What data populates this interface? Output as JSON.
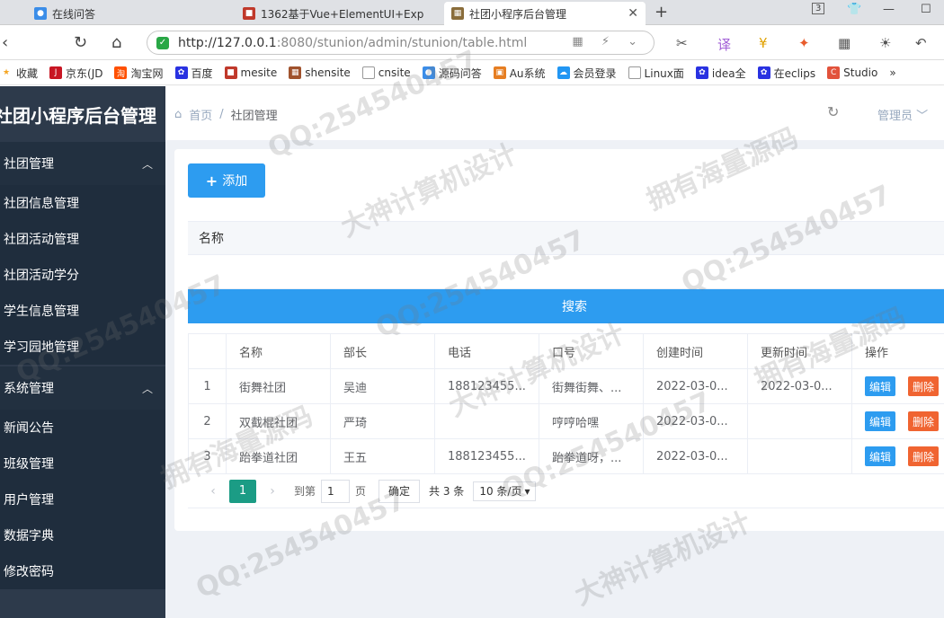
{
  "browser": {
    "tabs": [
      {
        "title": "在线问答",
        "active": false
      },
      {
        "title": "1362基于Vue+ElementUI+Exp",
        "active": false
      },
      {
        "title": "社团小程序后台管理",
        "active": true
      }
    ],
    "url_prefix": "http://127.0.0.1",
    "url_rest": ":8080/stunion/admin/stunion/table.html",
    "tab_badge": "3",
    "bookmarks": [
      "收藏",
      "京东(JD",
      "淘宝网",
      "百度",
      "mesite",
      "shensite",
      "cnsite",
      "源码问答",
      "Au系统",
      "会员登录",
      "Linux面",
      "idea全",
      "在eclips",
      "Studio",
      "»"
    ]
  },
  "sidebar": {
    "title": "社团小程序后台管理",
    "groups": [
      {
        "label": "社团管理",
        "items": [
          "社团信息管理",
          "社团活动管理",
          "社团活动学分",
          "学生信息管理",
          "学习园地管理"
        ]
      },
      {
        "label": "系统管理",
        "items": [
          "新闻公告",
          "班级管理",
          "用户管理",
          "数据字典",
          "修改密码"
        ]
      }
    ]
  },
  "header": {
    "breadcrumb_home": "首页",
    "breadcrumb_sep": "/",
    "breadcrumb_current": "社团管理",
    "user_label": "管理员"
  },
  "toolbar": {
    "add_label": "添加",
    "filter_label": "名称",
    "search_label": "搜索"
  },
  "table": {
    "columns": [
      "",
      "名称",
      "部长",
      "电话",
      "口号",
      "创建时间",
      "更新时间",
      "操作"
    ],
    "edit_label": "编辑",
    "delete_label": "删除",
    "rows": [
      {
        "index": "1",
        "name": "街舞社团",
        "leader": "吴迪",
        "phone": "188123455...",
        "slogan": "街舞街舞、...",
        "created": "2022-03-0...",
        "updated": "2022-03-0..."
      },
      {
        "index": "2",
        "name": "双截棍社团",
        "leader": "严琦",
        "phone": "",
        "slogan": "哼哼哈嘿",
        "created": "2022-03-0...",
        "updated": ""
      },
      {
        "index": "3",
        "name": "跆拳道社团",
        "leader": "王五",
        "phone": "188123455...",
        "slogan": "跆拳道呀，...",
        "created": "2022-03-0...",
        "updated": ""
      }
    ]
  },
  "pagination": {
    "current_page": "1",
    "goto_label": "到第",
    "goto_value": "1",
    "page_suffix": "页",
    "confirm_label": "确定",
    "total_label": "共 3 条",
    "page_size_label": "10 条/页"
  },
  "watermarks": [
    "QQ:254540457",
    "大神计算机设计",
    "拥有海量源码"
  ]
}
